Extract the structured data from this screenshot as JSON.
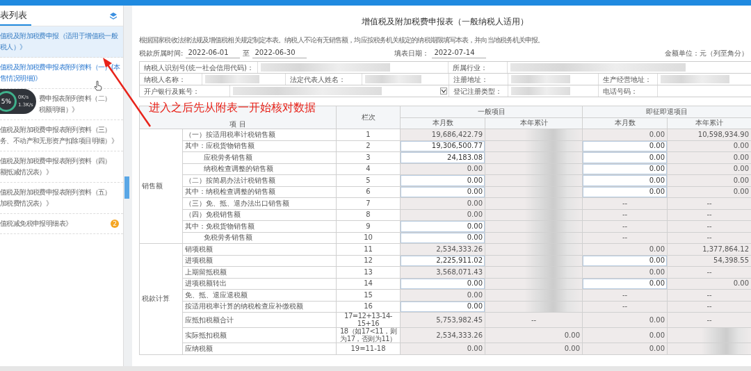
{
  "sidebar": {
    "title": "表列表",
    "items": [
      {
        "lines": [
          "值税及附加税费申报（适用于增值税一般",
          "税人）》"
        ],
        "selected": true,
        "hovered": false
      },
      {
        "lines": [
          "值税及附加税费申报表附列资料（一）(本",
          "售情况明细)》"
        ],
        "selected": false,
        "hovered": true
      },
      {
        "lines": [
          "费申报表附列资料（二）",
          "税额明细）》"
        ],
        "selected": false,
        "hovered": false,
        "overlay": {
          "percent": "5%",
          "upload": "0K/s",
          "download": "1.3K/s"
        }
      },
      {
        "lines": [
          "值税及附加税费申报表附列资料（三）",
          "务、不动产和无形资产扣除项目明细）》"
        ],
        "selected": false,
        "hovered": false
      },
      {
        "lines": [
          "值税及附加税费申报表附列资料（四）",
          "额抵减情况表）》"
        ],
        "selected": false,
        "hovered": false
      },
      {
        "lines": [
          "值税及附加税费申报表附列资料（五）",
          "加税费情况表）》"
        ],
        "selected": false,
        "hovered": false
      },
      {
        "lines": [
          "值税减免税申报明细表》"
        ],
        "selected": false,
        "hovered": false,
        "badge": "2"
      }
    ]
  },
  "annotation": {
    "text": "进入之后先从附表一开始核对数据"
  },
  "form": {
    "title": "增值税及附加税费申报表（一般纳税人适用）",
    "note": "根据国家税收法律法规及增值税相关规定制定本表。纳税人不论有无销售额，均应按税务机关核定的纳税期限填写本表，并向当地税务机关申报。",
    "period_label": "税款所属时间:",
    "period_from": "2022-06-01",
    "period_to_label": "至",
    "period_to": "2022-06-30",
    "fill_date_label": "填表日期：",
    "fill_date": "2022-07-14",
    "unit": "金额单位：元（列至角分）",
    "info_rows": [
      [
        {
          "label": "纳税人识别号(统一社会信用代码)：",
          "value_redacted": true
        },
        {
          "label": "所属行业：",
          "value_redacted": true
        }
      ],
      [
        {
          "label": "纳税人名称：",
          "value_redacted": true
        },
        {
          "label": "法定代表人姓名：",
          "value_redacted": true
        },
        {
          "label": "注册地址：",
          "value_redacted": true
        },
        {
          "label": "生产经营地址：",
          "value_redacted": true
        }
      ],
      [
        {
          "label": "开户银行及账号：",
          "value_redacted": true,
          "dropdown": true
        },
        {
          "label": "登记注册类型：",
          "value_redacted": true
        },
        {
          "label": "电话号码：",
          "value_redacted": false
        }
      ]
    ],
    "columns": {
      "item": "项 目",
      "line": "栏次",
      "groups": [
        "一般项目",
        "即征即退项目"
      ],
      "subs": [
        "本月数",
        "本年累计",
        "本月数",
        "本年累计"
      ]
    },
    "sections": [
      {
        "label": "销售额",
        "rows": [
          {
            "item": "（一）按适用税率计税销售额",
            "kind": "main",
            "line": "1",
            "cells": [
              {
                "kind": "value",
                "text": "19,686,422.79",
                "editable": false
              },
              {
                "kind": "redacted"
              },
              {
                "kind": "value",
                "text": "0.00",
                "editable": false
              },
              {
                "kind": "value",
                "text": "10,598,934.90",
                "editable": false
              }
            ]
          },
          {
            "item": "其中：应税货物销售额",
            "kind": "main",
            "line": "2",
            "cells": [
              {
                "kind": "value",
                "text": "19,306,500.77",
                "editable": true
              },
              {
                "kind": "redacted"
              },
              {
                "kind": "value",
                "text": "0.00",
                "editable": true
              },
              {
                "kind": "value",
                "text": "0.00",
                "editable": false
              }
            ]
          },
          {
            "item": "应税劳务销售额",
            "kind": "sub",
            "line": "3",
            "cells": [
              {
                "kind": "value",
                "text": "24,183.08",
                "editable": true
              },
              {
                "kind": "redacted"
              },
              {
                "kind": "value",
                "text": "0.00",
                "editable": true
              },
              {
                "kind": "value",
                "text": "0.00",
                "editable": false
              }
            ]
          },
          {
            "item": "纳税检查调整的销售额",
            "kind": "sub",
            "line": "4",
            "cells": [
              {
                "kind": "value",
                "text": "0.00",
                "editable": false
              },
              {
                "kind": "redacted"
              },
              {
                "kind": "value",
                "text": "0.00",
                "editable": true
              },
              {
                "kind": "value",
                "text": "0.00",
                "editable": false
              }
            ]
          },
          {
            "item": "（二）按简易办法计税销售额",
            "kind": "main",
            "line": "5",
            "cells": [
              {
                "kind": "value",
                "text": "0.00",
                "editable": true
              },
              {
                "kind": "redacted"
              },
              {
                "kind": "value",
                "text": "0.00",
                "editable": true
              },
              {
                "kind": "value",
                "text": "0.00",
                "editable": false
              }
            ]
          },
          {
            "item": "其中：纳税检查调整的销售额",
            "kind": "main",
            "line": "6",
            "cells": [
              {
                "kind": "value",
                "text": "0.00",
                "editable": true
              },
              {
                "kind": "redacted"
              },
              {
                "kind": "value",
                "text": "0.00",
                "editable": true
              },
              {
                "kind": "value",
                "text": "0.00",
                "editable": false
              }
            ]
          },
          {
            "item": "（三）免、抵、退办法出口销售额",
            "kind": "main",
            "line": "7",
            "cells": [
              {
                "kind": "value",
                "text": "0.00",
                "editable": false
              },
              {
                "kind": "redacted"
              },
              {
                "kind": "dash",
                "text": "--"
              },
              {
                "kind": "dash",
                "text": "--"
              }
            ]
          },
          {
            "item": "（四）免税销售额",
            "kind": "main",
            "line": "8",
            "cells": [
              {
                "kind": "value",
                "text": "0.00",
                "editable": false
              },
              {
                "kind": "redacted"
              },
              {
                "kind": "dash",
                "text": "--"
              },
              {
                "kind": "dash",
                "text": "--"
              }
            ]
          },
          {
            "item": "其中：免税货物销售额",
            "kind": "main",
            "line": "9",
            "cells": [
              {
                "kind": "value",
                "text": "0.00",
                "editable": true
              },
              {
                "kind": "redacted"
              },
              {
                "kind": "dash",
                "text": "--"
              },
              {
                "kind": "dash",
                "text": "--"
              }
            ]
          },
          {
            "item": "免税劳务销售额",
            "kind": "sub",
            "line": "10",
            "cells": [
              {
                "kind": "value",
                "text": "0.00",
                "editable": true
              },
              {
                "kind": "redacted"
              },
              {
                "kind": "dash",
                "text": "--"
              },
              {
                "kind": "dash",
                "text": "--"
              }
            ]
          }
        ]
      },
      {
        "label": "税款计算",
        "rows": [
          {
            "item": "销项税额",
            "kind": "main",
            "line": "11",
            "cells": [
              {
                "kind": "value",
                "text": "2,534,333.26",
                "editable": false
              },
              {
                "kind": "redacted"
              },
              {
                "kind": "value",
                "text": "0.00",
                "editable": false
              },
              {
                "kind": "value",
                "text": "1,377,864.12",
                "editable": false
              }
            ]
          },
          {
            "item": "进项税额",
            "kind": "main",
            "line": "12",
            "cells": [
              {
                "kind": "value",
                "text": "2,225,911.02",
                "editable": true
              },
              {
                "kind": "redacted"
              },
              {
                "kind": "value",
                "text": "0.00",
                "editable": true
              },
              {
                "kind": "value",
                "text": "54,398.55",
                "editable": false
              }
            ]
          },
          {
            "item": "上期留抵税额",
            "kind": "main",
            "line": "13",
            "cells": [
              {
                "kind": "value",
                "text": "3,568,071.43",
                "editable": false
              },
              {
                "kind": "redacted"
              },
              {
                "kind": "value",
                "text": "0.00",
                "editable": false
              },
              {
                "kind": "dash",
                "text": "--"
              }
            ]
          },
          {
            "item": "进项税额转出",
            "kind": "main",
            "line": "14",
            "cells": [
              {
                "kind": "value",
                "text": "0.00",
                "editable": true
              },
              {
                "kind": "redacted"
              },
              {
                "kind": "value",
                "text": "0.00",
                "editable": true
              },
              {
                "kind": "value",
                "text": "0.00",
                "editable": false
              }
            ]
          },
          {
            "item": "免、抵、退应退税额",
            "kind": "main",
            "line": "15",
            "cells": [
              {
                "kind": "value",
                "text": "0.00",
                "editable": false
              },
              {
                "kind": "redacted"
              },
              {
                "kind": "dash",
                "text": "--"
              },
              {
                "kind": "dash",
                "text": "--"
              }
            ]
          },
          {
            "item": "按适用税率计算的纳税检查应补缴税额",
            "kind": "main",
            "line": "16",
            "cells": [
              {
                "kind": "value",
                "text": "0.00",
                "editable": true
              },
              {
                "kind": "redacted"
              },
              {
                "kind": "dash",
                "text": "--"
              },
              {
                "kind": "dash",
                "text": "--"
              }
            ]
          },
          {
            "item": "应抵扣税额合计",
            "kind": "main",
            "line": "17=12+13-14-15+16",
            "cells": [
              {
                "kind": "value",
                "text": "5,753,982.45",
                "editable": false
              },
              {
                "kind": "dash",
                "text": "--"
              },
              {
                "kind": "value",
                "text": "0.00",
                "editable": false
              },
              {
                "kind": "dash",
                "text": "--"
              }
            ]
          },
          {
            "item": "实际抵扣税额",
            "kind": "main",
            "line": "18（如17<11，则为17，否则为11）",
            "cells": [
              {
                "kind": "value",
                "text": "2,534,333.26",
                "editable": false
              },
              {
                "kind": "value",
                "text": "0.00",
                "editable": false
              },
              {
                "kind": "value",
                "text": "0.00",
                "editable": false
              },
              {
                "kind": "redacted"
              }
            ]
          },
          {
            "item": "应纳税额",
            "kind": "main",
            "line": "19=11-18",
            "cells": [
              {
                "kind": "value",
                "text": "0.00",
                "editable": false
              },
              {
                "kind": "value",
                "text": "0.00",
                "editable": false
              },
              {
                "kind": "value",
                "text": "0.00",
                "editable": false
              },
              {
                "kind": "redacted"
              }
            ]
          }
        ]
      }
    ]
  }
}
